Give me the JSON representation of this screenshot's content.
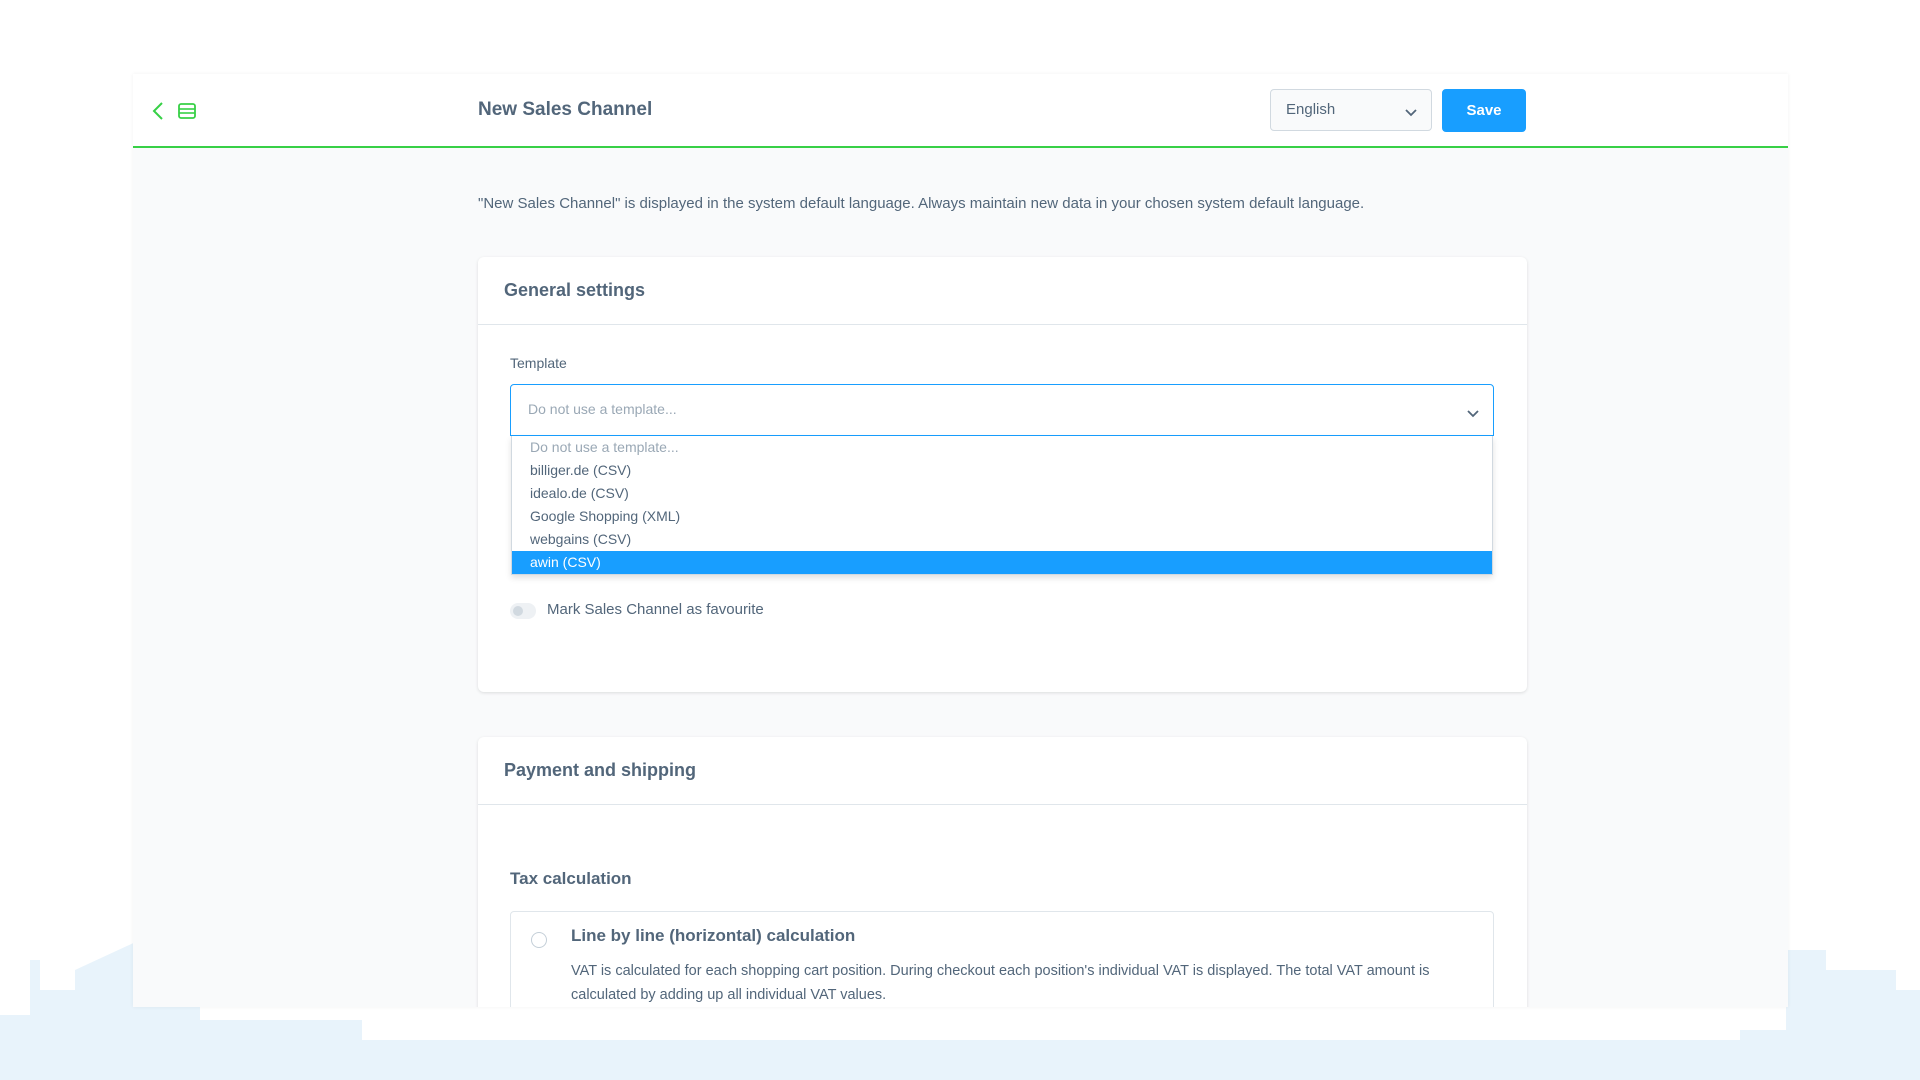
{
  "header": {
    "title": "New Sales Channel",
    "language": "English",
    "save_label": "Save"
  },
  "notice": "\"New Sales Channel\" is displayed in the system default language. Always maintain new data in your chosen system default language.",
  "general": {
    "title": "General settings",
    "template_label": "Template",
    "template_placeholder": "Do not use a template...",
    "options": [
      "Do not use a template...",
      "billiger.de (CSV)",
      "idealo.de (CSV)",
      "Google Shopping (XML)",
      "webgains (CSV)",
      "awin (CSV)"
    ],
    "highlighted_option": "awin (CSV)",
    "favourite_label": "Mark Sales Channel as favourite",
    "favourite_on": false
  },
  "payment": {
    "title": "Payment and shipping",
    "tax_heading": "Tax calculation",
    "option_title": "Line by line (horizontal) calculation",
    "option_desc": "VAT is calculated for each shopping cart position. During checkout each position's individual VAT is displayed. The total VAT amount is calculated by adding up all individual VAT values."
  },
  "colors": {
    "accent": "#189eff",
    "divider": "#37d046",
    "text": "#52667a"
  },
  "icons": [
    "arrow-left-icon",
    "list-icon",
    "chevron-down-icon"
  ]
}
